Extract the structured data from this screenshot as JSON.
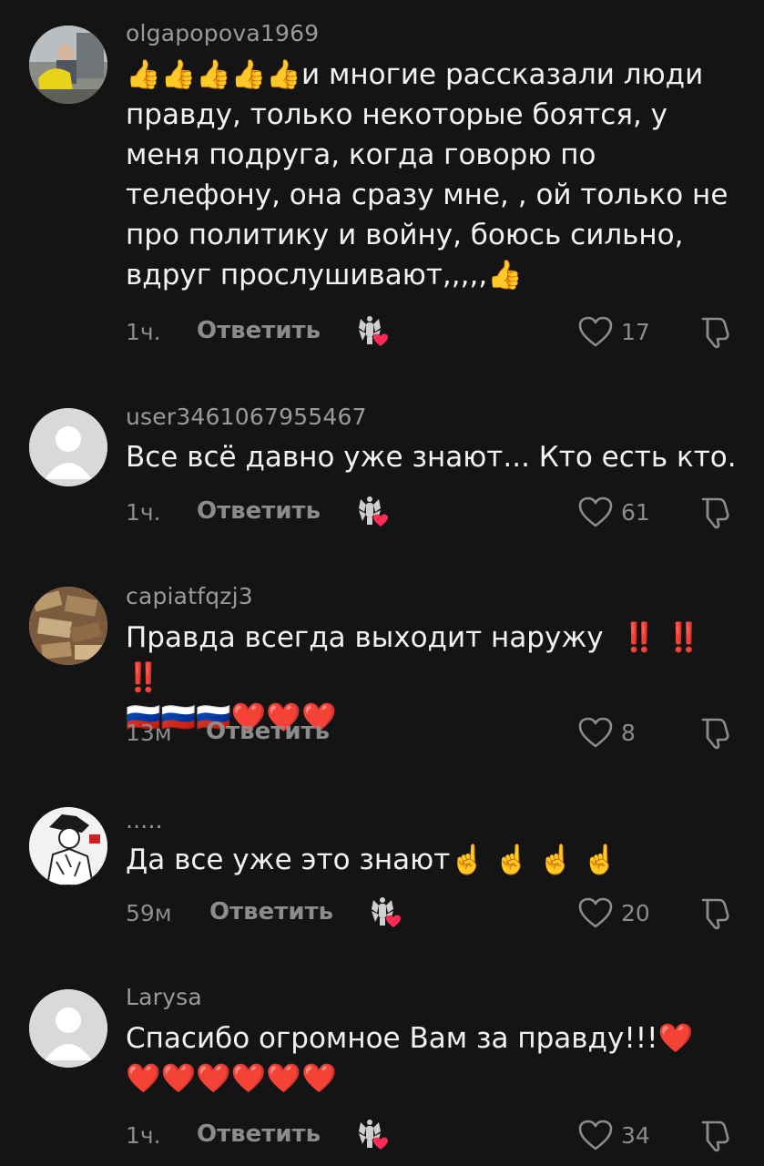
{
  "comments": [
    {
      "username": "olgapopova1969",
      "prefix_emoji": "👍👍👍👍👍",
      "text": "и многие рассказали люди правду, только некоторые боятся, у меня подруга, когда говорю по телефону, она сразу мне, , ой только не про политику и войну, боюсь сильно, вдруг прослушивают,,,,,",
      "suffix_emoji": "👍",
      "time": "1ч.",
      "reply_label": "Ответить",
      "likes": "17",
      "creator_liked": true
    },
    {
      "username": "user3461067955467",
      "text": "Все всё давно уже знают... Кто есть кто.",
      "time": "1ч.",
      "reply_label": "Ответить",
      "likes": "61",
      "creator_liked": true
    },
    {
      "username": "capiatfqzj3",
      "text": "Правда всегда выходит наружу",
      "suffix_emoji": "‼️ ‼️ ‼️",
      "second_line_emoji": "🇷🇺🇷🇺🇷🇺❤️❤️❤️",
      "time": "13м",
      "reply_label": "Ответить",
      "likes": "8",
      "creator_liked": false
    },
    {
      "username": ".....",
      "text": "Да все уже это знают",
      "suffix_emoji": "☝️ ☝️ ☝️ ☝️",
      "time": "59м",
      "reply_label": "Ответить",
      "likes": "20",
      "creator_liked": true
    },
    {
      "username": "Larysa",
      "text": "Спасибо огромное Вам за правду!!!",
      "suffix_emoji": "❤️",
      "second_line_emoji": "❤️❤️❤️❤️❤️❤️",
      "time": "1ч.",
      "reply_label": "Ответить",
      "likes": "34",
      "creator_liked": true
    }
  ],
  "colors": {
    "background": "#141414",
    "secondary_text": "#8c8c8c",
    "heart": "#fe2c55"
  }
}
